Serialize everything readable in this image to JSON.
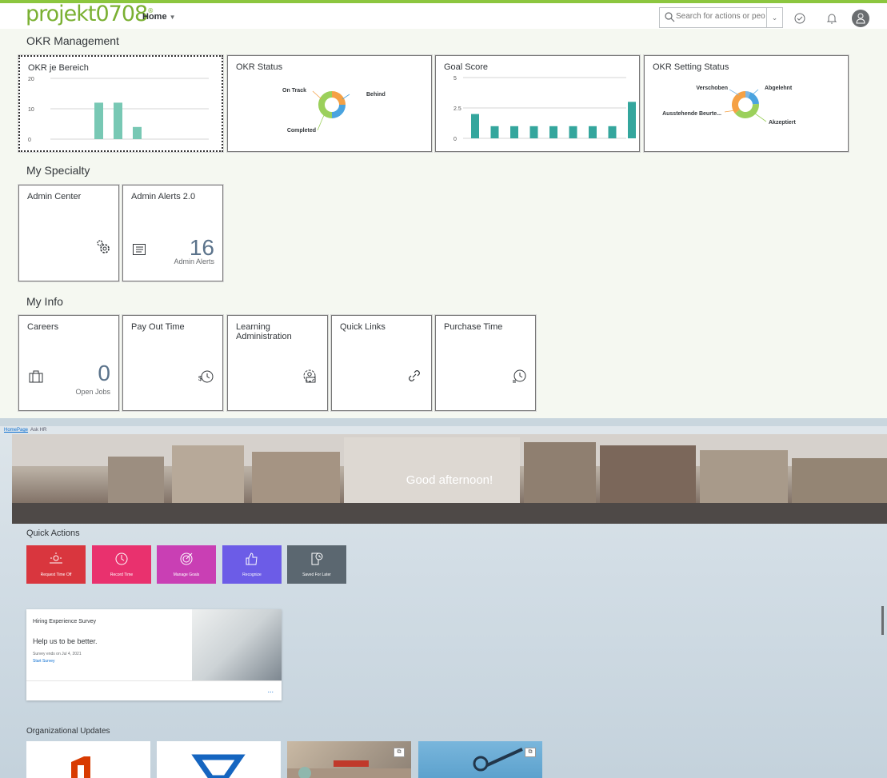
{
  "shell": {
    "logo": "projekt0708",
    "home_label": "Home",
    "search_placeholder": "Search for actions or peo..."
  },
  "sections": {
    "okr": "OKR Management",
    "specialty": "My Specialty",
    "info": "My Info"
  },
  "okr_tiles": {
    "bereich": {
      "title": "OKR je Bereich"
    },
    "status": {
      "title": "OKR Status"
    },
    "goal": {
      "title": "Goal Score"
    },
    "setting": {
      "title": "OKR Setting Status"
    }
  },
  "chart_data": [
    {
      "type": "bar",
      "title": "OKR je Bereich",
      "ylim": [
        0,
        20
      ],
      "yticks": [
        "20",
        "10",
        "0"
      ],
      "values": [
        12,
        12,
        4
      ],
      "color": "#78c8b4"
    },
    {
      "type": "pie",
      "title": "OKR Status",
      "labels": [
        "On Track",
        "Behind",
        "Completed"
      ],
      "values": [
        25,
        25,
        50
      ],
      "colors": [
        "#f5a145",
        "#4aa3df",
        "#9bd05b"
      ]
    },
    {
      "type": "bar",
      "title": "Goal Score",
      "ylim": [
        0,
        5
      ],
      "yticks": [
        "5",
        "2.5",
        "0"
      ],
      "values": [
        2,
        1,
        1,
        1,
        1,
        1,
        1,
        1,
        3
      ],
      "color": "#34a69d"
    },
    {
      "type": "pie",
      "title": "OKR Setting Status",
      "labels": [
        "Verschoben",
        "Abgelehnt",
        "Akzeptiert",
        "Ausstehende Beurte..."
      ],
      "values": [
        6,
        18,
        40,
        36
      ],
      "colors": [
        "#7fb7e3",
        "#4aa3df",
        "#9bd05b",
        "#f5a145"
      ]
    }
  ],
  "specialty": {
    "admin_center": {
      "title": "Admin Center",
      "icon": "gears-icon"
    },
    "admin_alerts": {
      "title": "Admin Alerts 2.0",
      "value": "16",
      "sub": "Admin Alerts",
      "icon": "list-icon"
    }
  },
  "info": {
    "careers": {
      "title": "Careers",
      "value": "0",
      "sub": "Open Jobs",
      "icon": "briefcase-icon"
    },
    "payout": {
      "title": "Pay Out Time",
      "icon": "money-clock-icon"
    },
    "learning": {
      "title": "Learning Administration",
      "icon": "learning-admin-icon"
    },
    "quicklinks": {
      "title": "Quick Links",
      "icon": "link-icon"
    },
    "purchase": {
      "title": "Purchase Time",
      "icon": "clock-list-icon"
    }
  },
  "lower": {
    "breadcrumb": {
      "home": "HomePage",
      "ask": "Ask HR"
    },
    "greeting": "Good afternoon!",
    "quick_actions_title": "Quick Actions",
    "quick_actions": [
      {
        "label": "Request Time Off",
        "color": "#d9363e"
      },
      {
        "label": "Record Time",
        "color": "#e9316e"
      },
      {
        "label": "Manage Goals",
        "color": "#c93fb4"
      },
      {
        "label": "Recognize",
        "color": "#6c5ce7"
      },
      {
        "label": "Saved For Later",
        "color": "#5b6770"
      }
    ],
    "survey": {
      "title": "Hiring Experience Survey",
      "heading": "Help us to be better.",
      "ends": "Survey ends on Jul 4, 2021",
      "link": "Start Survey",
      "more": "..."
    },
    "org_updates_title": "Organizational Updates"
  }
}
